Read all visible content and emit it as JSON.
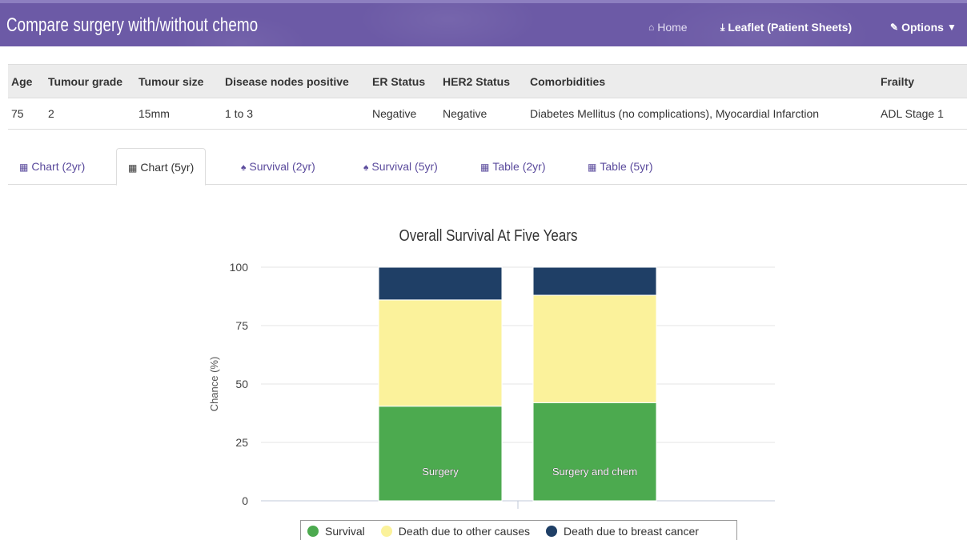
{
  "header": {
    "title": "Compare surgery with/without chemo",
    "nav": {
      "home": "Home",
      "leaflet": "Leaflet (Patient Sheets)",
      "options": "Options"
    },
    "icons": {
      "home": "home-icon",
      "leaflet": "download-icon",
      "options": "edit-icon",
      "options_caret": "caret-down-icon"
    }
  },
  "patient_table": {
    "headers": [
      "Age",
      "Tumour grade",
      "Tumour size",
      "Disease nodes positive",
      "ER Status",
      "HER2 Status",
      "Comorbidities",
      "Frailty"
    ],
    "row": [
      "75",
      "2",
      "15mm",
      "1 to 3",
      "Negative",
      "Negative",
      "Diabetes Mellitus (no complications), Myocardial Infarction",
      "ADL Stage 1"
    ]
  },
  "tabs": [
    {
      "label": "Chart (2yr)",
      "icon": "bar-chart-icon",
      "active": false
    },
    {
      "label": "Chart (5yr)",
      "icon": "bar-chart-icon",
      "active": true
    },
    {
      "label": "Survival (2yr)",
      "icon": "person-icon",
      "active": false
    },
    {
      "label": "Survival (5yr)",
      "icon": "person-icon",
      "active": false
    },
    {
      "label": "Table (2yr)",
      "icon": "table-icon",
      "active": false
    },
    {
      "label": "Table (5yr)",
      "icon": "table-icon",
      "active": false
    }
  ],
  "chart_data": {
    "type": "bar",
    "stacked": true,
    "title": "Overall Survival At Five Years",
    "ylabel": "Chance (%)",
    "xlabel": "",
    "ylim": [
      0,
      100
    ],
    "yticks": [
      0,
      25,
      50,
      75,
      100
    ],
    "grid": true,
    "categories": [
      "Surgery",
      "Surgery and chem"
    ],
    "series": [
      {
        "name": "Survival",
        "values": [
          40.5,
          42
        ],
        "color": "#4caa4f"
      },
      {
        "name": "Death due to other causes",
        "values": [
          45.5,
          46
        ],
        "color": "#fbf29b"
      },
      {
        "name": "Death due to breast cancer",
        "values": [
          14,
          12
        ],
        "color": "#1f3f66"
      }
    ],
    "legend": "bottom"
  }
}
